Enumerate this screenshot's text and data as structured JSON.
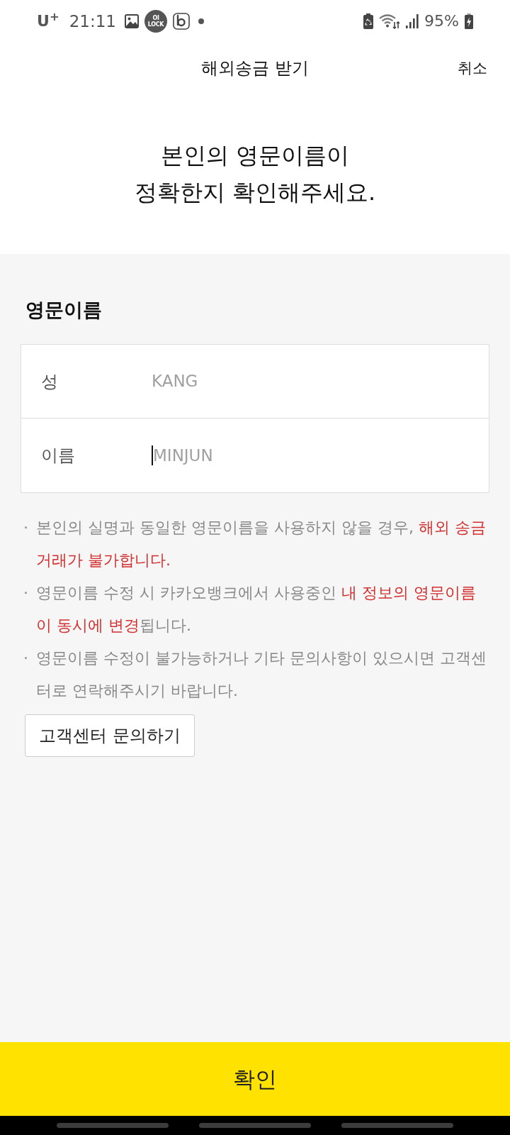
{
  "status_bar": {
    "carrier": "U$^{+}$",
    "time": "21:11",
    "app_badge_lines": [
      "OI",
      "LOCK"
    ],
    "battery_text": "95%"
  },
  "header": {
    "title": "해외송금 받기",
    "cancel": "취소"
  },
  "heading_lines": [
    "본인의 영문이름이",
    "정확한지 확인해주세요."
  ],
  "section_title": "영문이름",
  "fields": [
    {
      "label": "성",
      "value": "KANG",
      "focused": false
    },
    {
      "label": "이름",
      "value": "MINJUN",
      "focused": true
    }
  ],
  "notes": [
    {
      "bullet": "·",
      "segments": [
        {
          "text": "본인의 실명과 동일한 영문이름을 사용하지 않을 경우, ",
          "highlight": false
        },
        {
          "text": "해외 송금 거래가 불가합니다.",
          "highlight": true
        }
      ]
    },
    {
      "bullet": "·",
      "segments": [
        {
          "text": "영문이름 수정 시 카카오뱅크에서 사용중인 ",
          "highlight": false
        },
        {
          "text": "내 정보의 영문이름이 동시에 변경",
          "highlight": true
        },
        {
          "text": "됩니다.",
          "highlight": false
        }
      ]
    },
    {
      "bullet": "·",
      "segments": [
        {
          "text": "영문이름 수정이 불가능하거나 기타 문의사항이 있으시면 고객센터로 연락해주시기 바랍니다.",
          "highlight": false
        }
      ]
    }
  ],
  "support_button": "고객센터 문의하기",
  "confirm_button": "확인"
}
